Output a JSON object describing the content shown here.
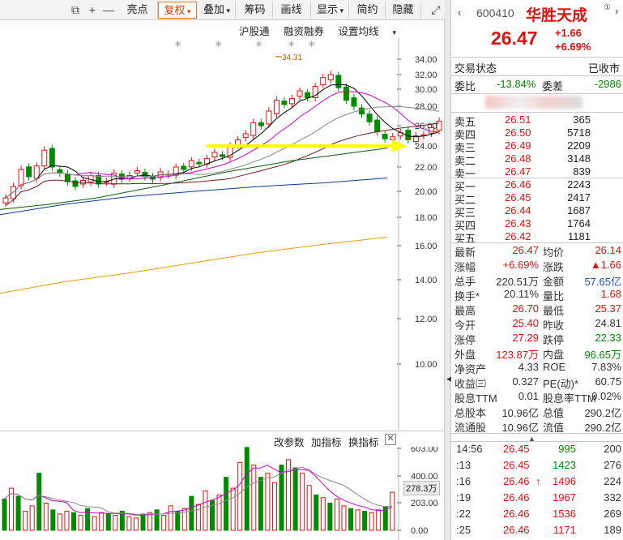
{
  "toolbar": {
    "buttons": [
      "亮点",
      "复权",
      "叠加",
      "筹码",
      "画线",
      "显示",
      "简约",
      "隐藏"
    ],
    "active": "复权"
  },
  "subbar": [
    "沪股通",
    "融资融券",
    "设置均线"
  ],
  "chart": {
    "price_ticks": [
      "34.00",
      "32.00",
      "30.00",
      "28.00",
      "26.00",
      "24.00",
      "22.00",
      "20.00",
      "18.00",
      "16.00",
      "14.00",
      "12.00",
      "10.00"
    ],
    "high_marker": "34.31",
    "vol_ticks": [
      "603.00",
      "400.00",
      "203.00",
      "0.00"
    ],
    "vol_current": "278.3万",
    "vol_header": [
      "改参数",
      "加指标",
      "换指标"
    ],
    "colors": {
      "up": "#e0100f",
      "down": "#008b00",
      "ma5": "#000000",
      "ma10": "#cc00cc",
      "ma20": "#7a1a1a",
      "ma30": "#888888",
      "ma60": "#0a5a0a",
      "ma120": "#0a3a9a",
      "ma250": "#e0a000",
      "arrow": "#ffff00"
    }
  },
  "stock": {
    "code": "600410",
    "name": "华胜天成",
    "price": "26.47",
    "change": "+1.66",
    "change_pct": "+6.69%"
  },
  "status": {
    "label": "交易状态",
    "value": "已收市"
  },
  "weibi": {
    "label1": "委比",
    "value1": "-13.84%",
    "label2": "委差",
    "value2": "-2986"
  },
  "asks": [
    {
      "label": "卖五",
      "price": "26.51",
      "vol": "365"
    },
    {
      "label": "卖四",
      "price": "26.50",
      "vol": "5718"
    },
    {
      "label": "卖三",
      "price": "26.49",
      "vol": "2209"
    },
    {
      "label": "卖二",
      "price": "26.48",
      "vol": "3148"
    },
    {
      "label": "卖一",
      "price": "26.47",
      "vol": "839"
    }
  ],
  "bids": [
    {
      "label": "买一",
      "price": "26.46",
      "vol": "2243"
    },
    {
      "label": "买二",
      "price": "26.45",
      "vol": "2417"
    },
    {
      "label": "买三",
      "price": "26.44",
      "vol": "1687"
    },
    {
      "label": "买四",
      "price": "26.43",
      "vol": "1764"
    },
    {
      "label": "买五",
      "price": "26.42",
      "vol": "1181"
    }
  ],
  "stats": [
    {
      "l1": "最新",
      "v1": "26.47",
      "c1": "red",
      "l2": "均价",
      "v2": "26.14",
      "c2": "red"
    },
    {
      "l1": "涨幅",
      "v1": "+6.69%",
      "c1": "red",
      "l2": "涨跌",
      "v2": "▲1.66",
      "c2": "red"
    },
    {
      "l1": "总手",
      "v1": "220.51万",
      "c1": "dim",
      "l2": "金额",
      "v2": "57.65亿",
      "c2": "blue"
    },
    {
      "l1": "换手*",
      "v1": "20.11%",
      "c1": "dim",
      "l2": "量比",
      "v2": "1.68",
      "c2": "red"
    },
    {
      "l1": "最高",
      "v1": "26.70",
      "c1": "red",
      "l2": "最低",
      "v2": "25.37",
      "c2": "red"
    },
    {
      "l1": "今开",
      "v1": "25.40",
      "c1": "red",
      "l2": "昨收",
      "v2": "24.81",
      "c2": "dim"
    },
    {
      "l1": "涨停",
      "v1": "27.29",
      "c1": "red",
      "l2": "跌停",
      "v2": "22.33",
      "c2": "green"
    },
    {
      "l1": "外盘",
      "v1": "123.87万",
      "c1": "red",
      "l2": "内盘",
      "v2": "96.65万",
      "c2": "green"
    },
    {
      "l1": "净资产",
      "v1": "4.33",
      "c1": "dim",
      "l2": "ROE",
      "v2": "7.83%",
      "c2": "dim"
    },
    {
      "l1": "收益㈢",
      "v1": "0.327",
      "c1": "dim",
      "l2": "PE(动)*",
      "v2": "60.75",
      "c2": "dim"
    },
    {
      "l1": "股息TTM",
      "v1": "0.01",
      "c1": "dim",
      "l2": "股息率TTM",
      "v2": "0.02%",
      "c2": "dim"
    },
    {
      "l1": "总股本",
      "v1": "10.96亿",
      "c1": "dim",
      "l2": "总值",
      "v2": "290.2亿",
      "c2": "dim"
    },
    {
      "l1": "流通股",
      "v1": "10.96亿",
      "c1": "dim",
      "l2": "流值",
      "v2": "290.2亿",
      "c2": "dim"
    }
  ],
  "ticks": [
    {
      "time": "14:56",
      "price": "26.45",
      "vol": "995",
      "n": "200",
      "arrow": ""
    },
    {
      "time": ":13",
      "price": "26.45",
      "vol": "1423",
      "n": "276",
      "arrow": ""
    },
    {
      "time": ":16",
      "price": "26.46",
      "vol": "1496",
      "n": "224",
      "arrow": "↑"
    },
    {
      "time": ":19",
      "price": "26.46",
      "vol": "1967",
      "n": "332",
      "arrow": ""
    },
    {
      "time": ":22",
      "price": "26.46",
      "vol": "1536",
      "n": "269",
      "arrow": ""
    },
    {
      "time": ":25",
      "price": "26.46",
      "vol": "1171",
      "n": "189",
      "arrow": ""
    }
  ]
}
